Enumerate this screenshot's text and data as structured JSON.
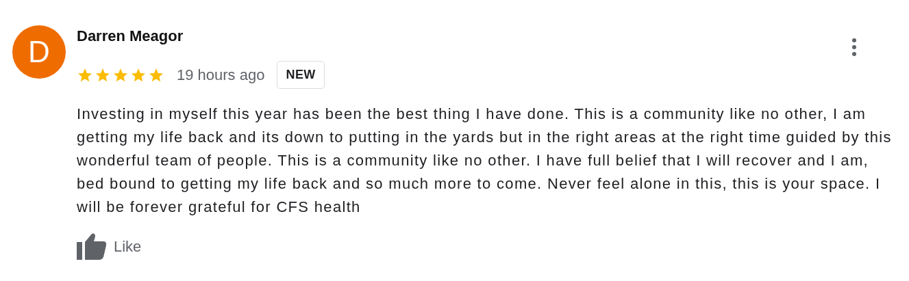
{
  "review": {
    "avatar_letter": "D",
    "author": "Darren Meagor",
    "stars": 5,
    "time": "19 hours ago",
    "badge": "NEW",
    "text": "Investing in myself this year has been the best thing I have done. This is a community like no other, I am getting my life back and its down to putting in the yards but in the right areas at the right time guided by this wonderful team of people. This is a community like no other. I have full belief that I will recover and I am, bed bound to getting my life back and so much more to come. Never feel alone in this, this is your space. I will be forever grateful for CFS health",
    "like_label": "Like"
  }
}
